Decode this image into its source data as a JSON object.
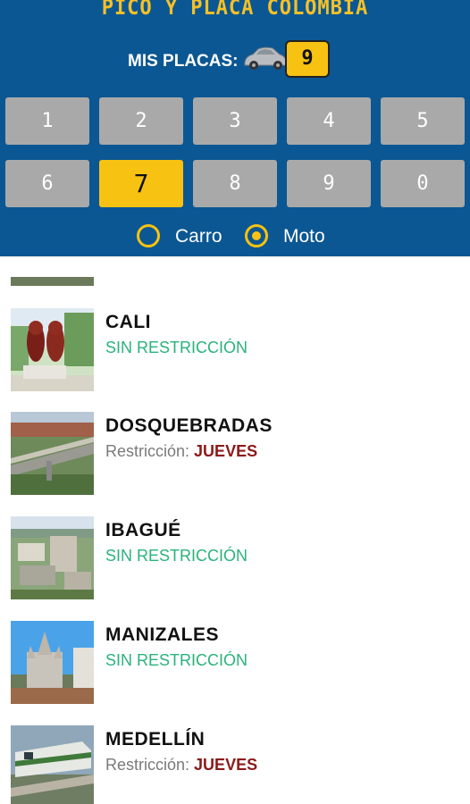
{
  "header": {
    "title": "PICO Y PLACA COLOMBIA",
    "plate_label": "MIS PLACAS:",
    "plate_value": "9",
    "car_icon": "car-icon",
    "accent": "#f8c212",
    "background": "#0b5793"
  },
  "digits": [
    "1",
    "2",
    "3",
    "4",
    "5",
    "6",
    "7",
    "8",
    "9",
    "0"
  ],
  "selected_digit": "7",
  "vehicle_types": {
    "carro": "Carro",
    "moto": "Moto",
    "selected": "Moto"
  },
  "cities": [
    {
      "name": "CALI",
      "status": "SIN RESTRICCIÓN"
    },
    {
      "name": "DOSQUEBRADAS",
      "label": "Restricción:",
      "day": "JUEVES"
    },
    {
      "name": "IBAGUÉ",
      "status": "SIN RESTRICCIÓN"
    },
    {
      "name": "MANIZALES",
      "status": "SIN RESTRICCIÓN"
    },
    {
      "name": "MEDELLÍN",
      "label": "Restricción:",
      "day": "JUEVES"
    }
  ]
}
